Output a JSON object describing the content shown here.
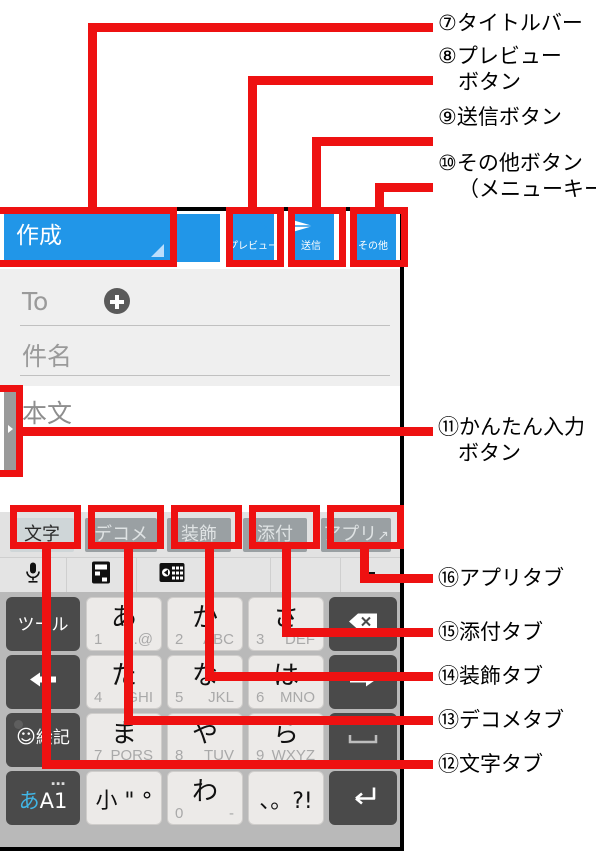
{
  "annotations": [
    {
      "id": "a7",
      "num": "⑦",
      "label": "タイトルバー",
      "label2": ""
    },
    {
      "id": "a8",
      "num": "⑧",
      "label": "プレビュー",
      "label2": "ボタン"
    },
    {
      "id": "a9",
      "num": "⑨",
      "label": "送信ボタン",
      "label2": ""
    },
    {
      "id": "a10",
      "num": "⑩",
      "label": "その他ボタン",
      "label2": "（メニューキー）"
    },
    {
      "id": "a11",
      "num": "⑪",
      "label": "かんたん入力",
      "label2": "ボタン"
    },
    {
      "id": "a16",
      "num": "⑯",
      "label": "アプリタブ",
      "label2": ""
    },
    {
      "id": "a15",
      "num": "⑮",
      "label": "添付タブ",
      "label2": ""
    },
    {
      "id": "a14",
      "num": "⑭",
      "label": "装飾タブ",
      "label2": ""
    },
    {
      "id": "a13",
      "num": "⑬",
      "label": "デコメタブ",
      "label2": ""
    },
    {
      "id": "a12",
      "num": "⑫",
      "label": "文字タブ",
      "label2": ""
    }
  ],
  "titlebar": {
    "title": "作成",
    "buttons": [
      {
        "icon": "play-circle-icon",
        "label": "プレビュー"
      },
      {
        "icon": "send-icon",
        "label": "送信"
      },
      {
        "icon": "overflow-menu-icon",
        "label": "その他"
      }
    ]
  },
  "compose": {
    "to_label": "To",
    "add_icon": "add-contact-icon",
    "subject_placeholder": "件名",
    "body_placeholder": "本文",
    "quick_input_icon": "chevron-right-icon"
  },
  "ime": {
    "tabs": [
      {
        "label": "文字",
        "active": true
      },
      {
        "label": "デコメ",
        "active": false
      },
      {
        "label": "装飾",
        "active": false
      },
      {
        "label": "添付",
        "active": false
      },
      {
        "label": "アプリ",
        "active": false,
        "arrow": "↗"
      }
    ],
    "icons": [
      "microphone-icon",
      "clipboard-icon",
      "keyboard-switch-icon",
      "blank-icon",
      "blank-icon",
      "resize-icon"
    ]
  },
  "keyboard": {
    "rows": [
      [
        {
          "type": "dark",
          "main": "ツール",
          "name": "tool-key"
        },
        {
          "type": "light",
          "main": "あ",
          "num": "1",
          "alpha": ".@",
          "name": "key-a"
        },
        {
          "type": "light",
          "main": "か",
          "num": "2",
          "alpha": "ABC",
          "name": "key-ka"
        },
        {
          "type": "light",
          "main": "さ",
          "num": "3",
          "alpha": "DEF",
          "name": "key-sa"
        },
        {
          "type": "dark",
          "icon": "backspace-icon",
          "name": "backspace-key"
        }
      ],
      [
        {
          "type": "dark",
          "icon": "arrow-left-icon",
          "name": "cursor-left-key"
        },
        {
          "type": "light",
          "main": "た",
          "num": "4",
          "alpha": "GHI",
          "name": "key-ta"
        },
        {
          "type": "light",
          "main": "な",
          "num": "5",
          "alpha": "JKL",
          "name": "key-na"
        },
        {
          "type": "light",
          "main": "は",
          "num": "6",
          "alpha": "MNO",
          "name": "key-ha"
        },
        {
          "type": "dark",
          "icon": "arrow-right-icon",
          "name": "cursor-right-key"
        }
      ],
      [
        {
          "type": "dark",
          "main": "絵記",
          "emoji": true,
          "name": "emoji-key"
        },
        {
          "type": "light",
          "main": "ま",
          "num": "7",
          "alpha": "PQRS",
          "name": "key-ma"
        },
        {
          "type": "light",
          "main": "や",
          "num": "8",
          "alpha": "TUV",
          "name": "key-ya"
        },
        {
          "type": "light",
          "main": "ら",
          "num": "9",
          "alpha": "WXYZ",
          "name": "key-ra"
        },
        {
          "type": "dark",
          "icon": "space-icon",
          "name": "space-key"
        }
      ],
      [
        {
          "type": "dark",
          "mode": "あA1",
          "name": "input-mode-key"
        },
        {
          "type": "light",
          "sym": "小 \" °",
          "name": "small-dakuten-key"
        },
        {
          "type": "light",
          "main": "わ",
          "num": "0",
          "alpha": "-",
          "name": "key-wa"
        },
        {
          "type": "light",
          "sym": "、。?!",
          "name": "punctuation-key"
        },
        {
          "type": "dark",
          "icon": "enter-icon",
          "name": "enter-key"
        }
      ]
    ]
  }
}
